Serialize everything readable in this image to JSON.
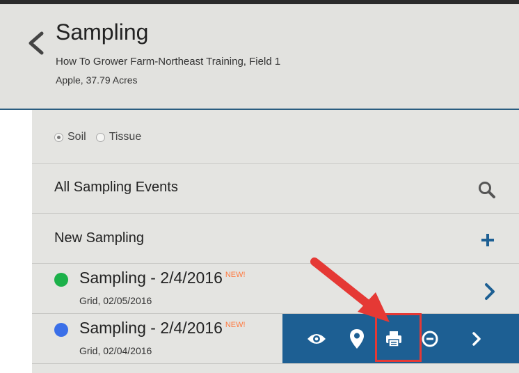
{
  "header": {
    "title": "Sampling",
    "subtitle_field": "How To Grower Farm-Northeast Training, Field 1",
    "subtitle_crop": "Apple, 37.79 Acres"
  },
  "sample_type": {
    "options": [
      "Soil",
      "Tissue"
    ],
    "selected": "Soil"
  },
  "menu": {
    "all_events_label": "All Sampling Events",
    "new_sampling_label": "New Sampling"
  },
  "samplings": [
    {
      "title": "Sampling - 2/4/2016",
      "badge": "NEW!",
      "detail": "Grid, 02/05/2016",
      "status_color": "#1cb14a"
    },
    {
      "title": "Sampling - 2/4/2016",
      "badge": "NEW!",
      "detail": "Grid, 02/04/2016",
      "status_color": "#3a6fe8"
    }
  ],
  "action_bar": {
    "icons": [
      "eye-icon",
      "map-pin-icon",
      "print-icon",
      "minus-circle-icon",
      "chevron-right-icon"
    ]
  },
  "colors": {
    "accent": "#1d5f93",
    "highlight": "#e53935",
    "badge": "#ff7a40"
  }
}
